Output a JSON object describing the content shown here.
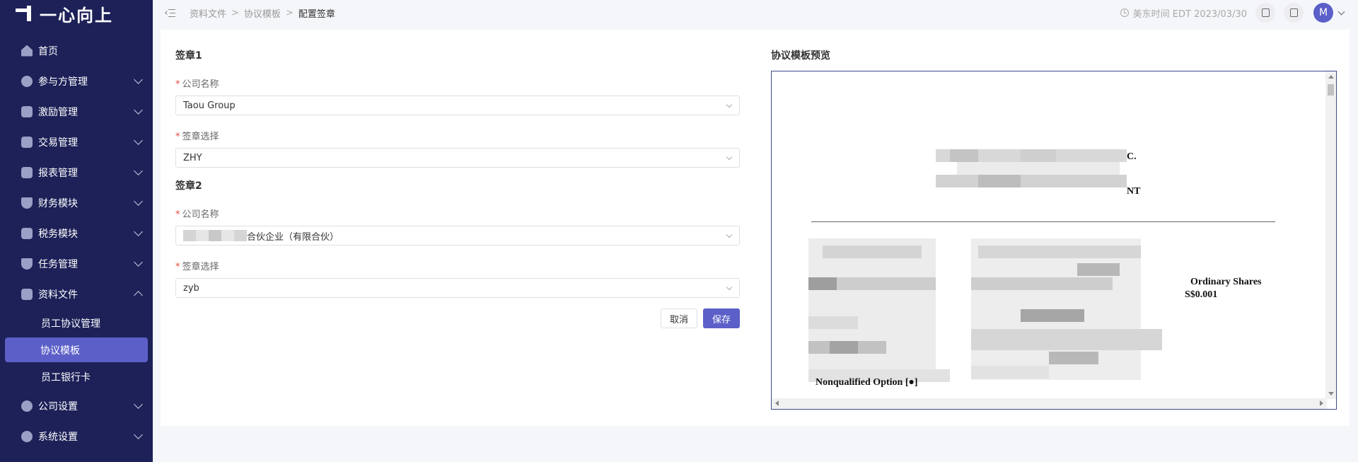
{
  "app": {
    "logo_text": "一心向上"
  },
  "sidebar": {
    "items": [
      {
        "label": "首页",
        "icon": "home-icon",
        "expandable": false
      },
      {
        "label": "参与方管理",
        "icon": "users-icon",
        "expandable": true
      },
      {
        "label": "激励管理",
        "icon": "star-icon",
        "expandable": true
      },
      {
        "label": "交易管理",
        "icon": "exchange-icon",
        "expandable": true
      },
      {
        "label": "报表管理",
        "icon": "report-icon",
        "expandable": true
      },
      {
        "label": "财务模块",
        "icon": "finance-icon",
        "expandable": true
      },
      {
        "label": "税务模块",
        "icon": "tax-icon",
        "expandable": true
      },
      {
        "label": "任务管理",
        "icon": "task-icon",
        "expandable": true
      },
      {
        "label": "资料文件",
        "icon": "folder-icon",
        "expandable": true,
        "expanded": true
      }
    ],
    "sub_items": [
      {
        "label": "员工协议管理",
        "active": false
      },
      {
        "label": "协议模板",
        "active": true
      },
      {
        "label": "员工银行卡",
        "active": false
      }
    ],
    "items_after": [
      {
        "label": "公司设置",
        "icon": "company-icon",
        "expandable": true
      },
      {
        "label": "系统设置",
        "icon": "settings-icon",
        "expandable": true
      }
    ]
  },
  "topbar": {
    "breadcrumb": [
      "资料文件",
      "协议模板",
      "配置签章"
    ],
    "timezone_text": "美东时间 EDT 2023/03/30",
    "avatar_letter": "M"
  },
  "form": {
    "seal1": {
      "title": "签章1",
      "company_label": "公司名称",
      "company_value": "Taou Group",
      "seal_label": "签章选择",
      "seal_value": "ZHY"
    },
    "seal2": {
      "title": "签章2",
      "company_label": "公司名称",
      "company_value_suffix": "合伙企业（有限合伙）",
      "seal_label": "签章选择",
      "seal_value": "zyb"
    },
    "required_mark": "*",
    "cancel_label": "取消",
    "save_label": "保存"
  },
  "preview": {
    "title": "协议模板预览",
    "doc_fragments": {
      "line1_tail": "C.",
      "line2_tail": "NT",
      "ordinary_shares": "Ordinary Shares",
      "par_value": "S$0.001",
      "option": "Nonqualified Option [●]"
    }
  },
  "colors": {
    "sidebar_bg": "#1d2158",
    "accent": "#5b5fc7",
    "required": "#e74c3c"
  }
}
